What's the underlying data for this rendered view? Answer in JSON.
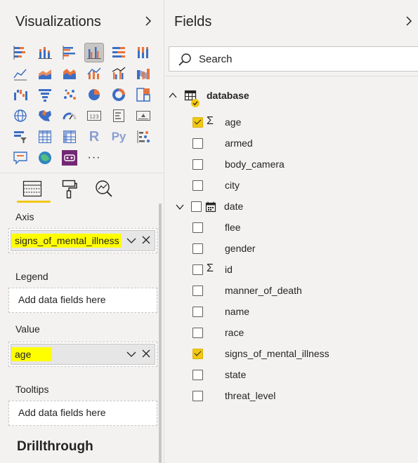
{
  "visualizations": {
    "title": "Visualizations",
    "more_label": "···",
    "r_label": "R",
    "py_label": "Py",
    "tabs": [
      "fields-tab",
      "format-tab",
      "analytics-tab"
    ],
    "axis": {
      "label": "Axis",
      "field": "signs_of_mental_illness"
    },
    "legend": {
      "label": "Legend",
      "placeholder": "Add data fields here"
    },
    "value": {
      "label": "Value",
      "field": "age"
    },
    "tooltips": {
      "label": "Tooltips",
      "placeholder": "Add data fields here"
    },
    "drillthrough": "Drillthrough",
    "colors": {
      "highlight": "#ffff00",
      "accent": "#f2c811",
      "viz_blue": "#3c6ec4",
      "viz_orange": "#e8743b"
    }
  },
  "fields": {
    "title": "Fields",
    "search": {
      "placeholder": "Search"
    },
    "table": {
      "name": "database"
    },
    "items": [
      {
        "name": "age",
        "checked": true,
        "sigma": true
      },
      {
        "name": "armed",
        "checked": false,
        "sigma": false
      },
      {
        "name": "body_camera",
        "checked": false,
        "sigma": false
      },
      {
        "name": "city",
        "checked": false,
        "sigma": false
      },
      {
        "name": "date",
        "checked": false,
        "sigma": false,
        "hierarchy": true
      },
      {
        "name": "flee",
        "checked": false,
        "sigma": false
      },
      {
        "name": "gender",
        "checked": false,
        "sigma": false
      },
      {
        "name": "id",
        "checked": false,
        "sigma": true
      },
      {
        "name": "manner_of_death",
        "checked": false,
        "sigma": false
      },
      {
        "name": "name",
        "checked": false,
        "sigma": false
      },
      {
        "name": "race",
        "checked": false,
        "sigma": false
      },
      {
        "name": "signs_of_mental_illness",
        "checked": true,
        "sigma": false
      },
      {
        "name": "state",
        "checked": false,
        "sigma": false
      },
      {
        "name": "threat_level",
        "checked": false,
        "sigma": false
      }
    ]
  }
}
